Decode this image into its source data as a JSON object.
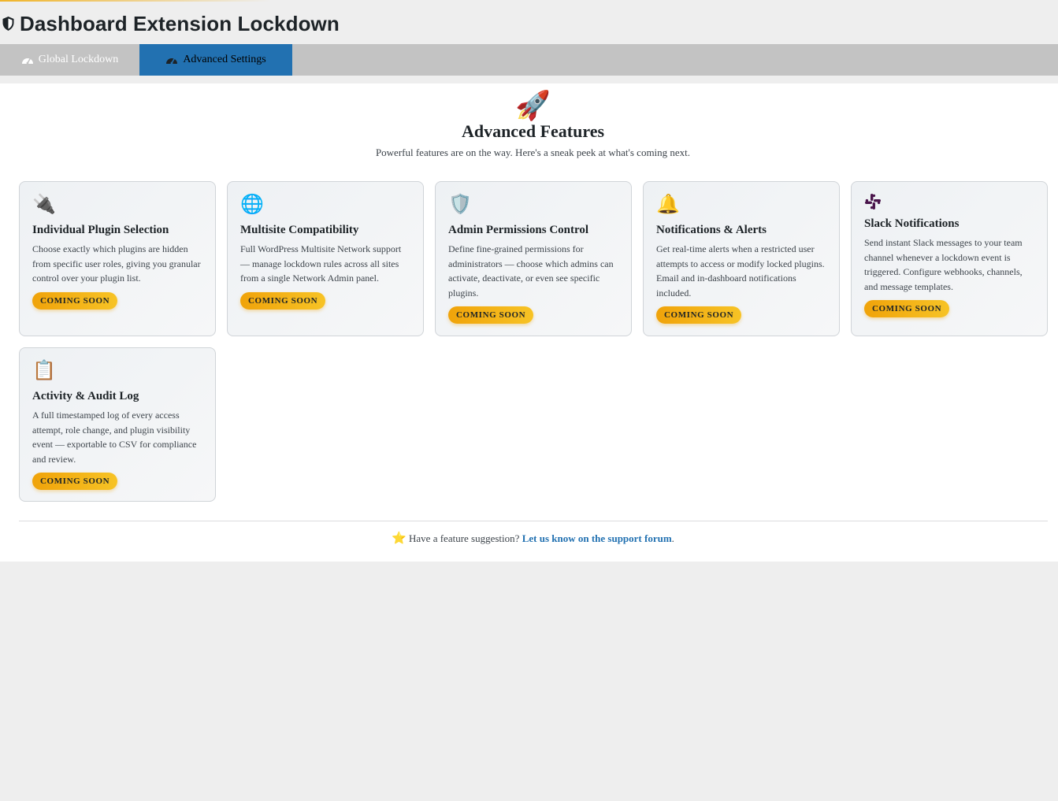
{
  "header": {
    "title": "Dashboard Extension Lockdown",
    "icon": "shield-icon"
  },
  "tabs": [
    {
      "label": "Global Lockdown",
      "icon": "gauge-icon",
      "active": false
    },
    {
      "label": "Advanced Settings",
      "icon": "gauge-icon",
      "active": true
    }
  ],
  "hero": {
    "icon": "🚀",
    "title": "Advanced Features",
    "subtitle": "Powerful features are on the way. Here's a sneak peek at what's coming next."
  },
  "features": [
    {
      "icon": "🔌",
      "title": "Individual Plugin Selection",
      "description": "Choose exactly which plugins are hidden from specific user roles, giving you granular control over your plugin list.",
      "badge": "COMING SOON"
    },
    {
      "icon": "🌐",
      "title": "Multisite Compatibility",
      "description": "Full WordPress Multisite Network support — manage lockdown rules across all sites from a single Network Admin panel.",
      "badge": "COMING SOON"
    },
    {
      "icon": "🛡️",
      "title": "Admin Permissions Control",
      "description": "Define fine-grained permissions for administrators — choose which admins can activate, deactivate, or even see specific plugins.",
      "badge": "COMING SOON"
    },
    {
      "icon": "🔔",
      "title": "Notifications & Alerts",
      "description": "Get real-time alerts when a restricted user attempts to access or modify locked plugins. Email and in-dashboard notifications included.",
      "badge": "COMING SOON"
    },
    {
      "icon": "slack-icon",
      "title": "Slack Notifications",
      "description": "Send instant Slack messages to your team channel whenever a lockdown event is triggered. Configure webhooks, channels, and message templates.",
      "badge": "COMING SOON"
    },
    {
      "icon": "📋",
      "title": "Activity & Audit Log",
      "description": "A full timestamped log of every access attempt, role change, and plugin visibility event — exportable to CSV for compliance and review.",
      "badge": "COMING SOON"
    }
  ],
  "footer": {
    "icon": "⭐",
    "text": "Have a feature suggestion?",
    "link_text": "Let us know on the support forum",
    "suffix": "."
  },
  "colors": {
    "accent": "#2271b1",
    "badge": "#f0a30a",
    "tab_bar": "#c3c3c3"
  }
}
